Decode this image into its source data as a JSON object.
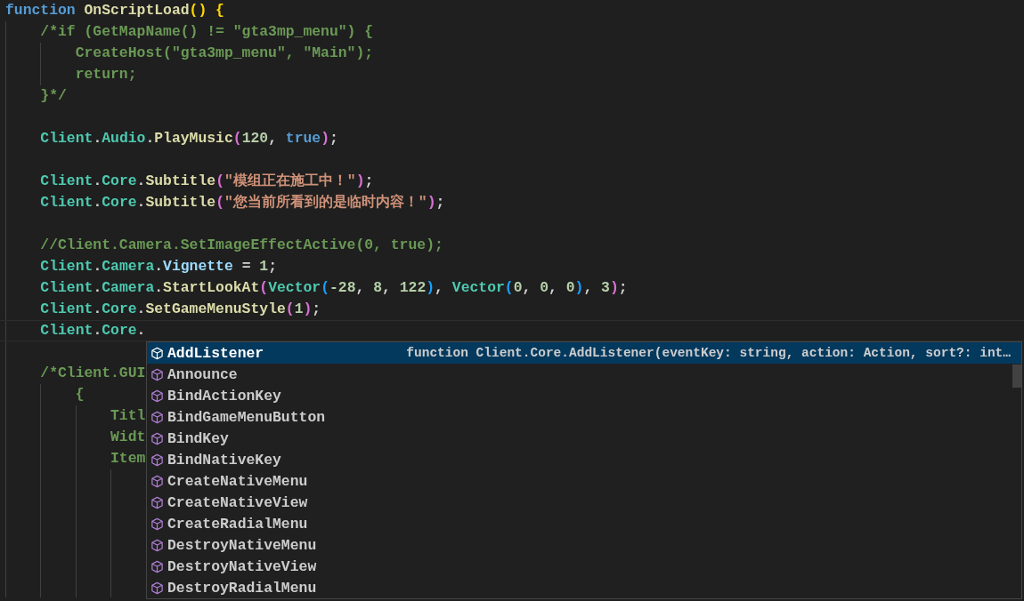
{
  "editor": {
    "lines": [
      {
        "current": false,
        "tokens": [
          {
            "text": "function ",
            "kind": "keyword"
          },
          {
            "text": "OnScriptLoad",
            "kind": "function"
          },
          {
            "text": "()",
            "kind": "bracket1"
          },
          {
            "text": " {",
            "kind": "bracket1"
          }
        ]
      },
      {
        "current": false,
        "tokens": [
          {
            "text": "    /*if (GetMapName() != \"gta3mp_menu\") {",
            "kind": "comment"
          }
        ]
      },
      {
        "current": false,
        "tokens": [
          {
            "text": "        CreateHost(\"gta3mp_menu\", \"Main\");",
            "kind": "comment"
          }
        ]
      },
      {
        "current": false,
        "tokens": [
          {
            "text": "        return;",
            "kind": "comment"
          }
        ]
      },
      {
        "current": false,
        "tokens": [
          {
            "text": "    }*/",
            "kind": "comment"
          }
        ]
      },
      {
        "current": false
      },
      {
        "current": false,
        "tokens": [
          {
            "text": "    Client",
            "kind": "class"
          },
          {
            "text": ".",
            "kind": "punct"
          },
          {
            "text": "Audio",
            "kind": "class"
          },
          {
            "text": ".",
            "kind": "punct"
          },
          {
            "text": "PlayMusic",
            "kind": "function"
          },
          {
            "text": "(",
            "kind": "bracket2"
          },
          {
            "text": "120",
            "kind": "number"
          },
          {
            "text": ", ",
            "kind": "punct"
          },
          {
            "text": "true",
            "kind": "keyword"
          },
          {
            "text": ")",
            "kind": "bracket2"
          },
          {
            "text": ";",
            "kind": "punct"
          }
        ]
      },
      {
        "current": false
      },
      {
        "current": false,
        "tokens": [
          {
            "text": "    Client",
            "kind": "class"
          },
          {
            "text": ".",
            "kind": "punct"
          },
          {
            "text": "Core",
            "kind": "class"
          },
          {
            "text": ".",
            "kind": "punct"
          },
          {
            "text": "Subtitle",
            "kind": "function"
          },
          {
            "text": "(",
            "kind": "bracket2"
          },
          {
            "text": "\"模组正在施工中！\"",
            "kind": "string"
          },
          {
            "text": ")",
            "kind": "bracket2"
          },
          {
            "text": ";",
            "kind": "punct"
          }
        ]
      },
      {
        "current": false,
        "tokens": [
          {
            "text": "    Client",
            "kind": "class"
          },
          {
            "text": ".",
            "kind": "punct"
          },
          {
            "text": "Core",
            "kind": "class"
          },
          {
            "text": ".",
            "kind": "punct"
          },
          {
            "text": "Subtitle",
            "kind": "function"
          },
          {
            "text": "(",
            "kind": "bracket2"
          },
          {
            "text": "\"您当前所看到的是临时内容！\"",
            "kind": "string"
          },
          {
            "text": ")",
            "kind": "bracket2"
          },
          {
            "text": ";",
            "kind": "punct"
          }
        ]
      },
      {
        "current": false
      },
      {
        "current": false,
        "tokens": [
          {
            "text": "    //Client.Camera.SetImageEffectActive(0, true);",
            "kind": "comment"
          }
        ]
      },
      {
        "current": false,
        "tokens": [
          {
            "text": "    Client",
            "kind": "class"
          },
          {
            "text": ".",
            "kind": "punct"
          },
          {
            "text": "Camera",
            "kind": "class"
          },
          {
            "text": ".",
            "kind": "punct"
          },
          {
            "text": "Vignette",
            "kind": "variable"
          },
          {
            "text": " = ",
            "kind": "punct"
          },
          {
            "text": "1",
            "kind": "number"
          },
          {
            "text": ";",
            "kind": "punct"
          }
        ]
      },
      {
        "current": false,
        "tokens": [
          {
            "text": "    Client",
            "kind": "class"
          },
          {
            "text": ".",
            "kind": "punct"
          },
          {
            "text": "Camera",
            "kind": "class"
          },
          {
            "text": ".",
            "kind": "punct"
          },
          {
            "text": "StartLookAt",
            "kind": "function"
          },
          {
            "text": "(",
            "kind": "bracket2"
          },
          {
            "text": "Vector",
            "kind": "class"
          },
          {
            "text": "(",
            "kind": "bracket3"
          },
          {
            "text": "-28",
            "kind": "number"
          },
          {
            "text": ", ",
            "kind": "punct"
          },
          {
            "text": "8",
            "kind": "number"
          },
          {
            "text": ", ",
            "kind": "punct"
          },
          {
            "text": "122",
            "kind": "number"
          },
          {
            "text": ")",
            "kind": "bracket3"
          },
          {
            "text": ", ",
            "kind": "punct"
          },
          {
            "text": "Vector",
            "kind": "class"
          },
          {
            "text": "(",
            "kind": "bracket3"
          },
          {
            "text": "0",
            "kind": "number"
          },
          {
            "text": ", ",
            "kind": "punct"
          },
          {
            "text": "0",
            "kind": "number"
          },
          {
            "text": ", ",
            "kind": "punct"
          },
          {
            "text": "0",
            "kind": "number"
          },
          {
            "text": ")",
            "kind": "bracket3"
          },
          {
            "text": ", ",
            "kind": "punct"
          },
          {
            "text": "3",
            "kind": "number"
          },
          {
            "text": ")",
            "kind": "bracket2"
          },
          {
            "text": ";",
            "kind": "punct"
          }
        ]
      },
      {
        "current": false,
        "tokens": [
          {
            "text": "    Client",
            "kind": "class"
          },
          {
            "text": ".",
            "kind": "punct"
          },
          {
            "text": "Core",
            "kind": "class"
          },
          {
            "text": ".",
            "kind": "punct"
          },
          {
            "text": "SetGameMenuStyle",
            "kind": "function"
          },
          {
            "text": "(",
            "kind": "bracket2"
          },
          {
            "text": "1",
            "kind": "number"
          },
          {
            "text": ")",
            "kind": "bracket2"
          },
          {
            "text": ";",
            "kind": "punct"
          }
        ]
      },
      {
        "current": true,
        "tokens": [
          {
            "text": "    Client",
            "kind": "class"
          },
          {
            "text": ".",
            "kind": "punct"
          },
          {
            "text": "Core",
            "kind": "class"
          },
          {
            "text": ".",
            "kind": "punct"
          }
        ]
      },
      {
        "current": false
      },
      {
        "current": false,
        "tokens": [
          {
            "text": "    /*Client.GUI",
            "kind": "comment"
          }
        ]
      },
      {
        "current": false,
        "tokens": [
          {
            "text": "        {",
            "kind": "comment"
          }
        ]
      },
      {
        "current": false,
        "tokens": [
          {
            "text": "            Titl",
            "kind": "comment"
          }
        ]
      },
      {
        "current": false,
        "tokens": [
          {
            "text": "            Widt",
            "kind": "comment"
          }
        ]
      },
      {
        "current": false,
        "tokens": [
          {
            "text": "            Item",
            "kind": "comment"
          }
        ]
      },
      {
        "current": false
      },
      {
        "current": false
      },
      {
        "current": false
      },
      {
        "current": false
      },
      {
        "current": false
      },
      {
        "current": false
      }
    ]
  },
  "suggestions": {
    "detail": "function Client.Core.AddListener(eventKey: string, action: Action, sort?: int…",
    "items": [
      {
        "label": "AddListener",
        "selected": true
      },
      {
        "label": "Announce",
        "selected": false
      },
      {
        "label": "BindActionKey",
        "selected": false
      },
      {
        "label": "BindGameMenuButton",
        "selected": false
      },
      {
        "label": "BindKey",
        "selected": false
      },
      {
        "label": "BindNativeKey",
        "selected": false
      },
      {
        "label": "CreateNativeMenu",
        "selected": false
      },
      {
        "label": "CreateNativeView",
        "selected": false
      },
      {
        "label": "CreateRadialMenu",
        "selected": false
      },
      {
        "label": "DestroyNativeMenu",
        "selected": false
      },
      {
        "label": "DestroyNativeView",
        "selected": false
      },
      {
        "label": "DestroyRadialMenu",
        "selected": false
      }
    ]
  }
}
